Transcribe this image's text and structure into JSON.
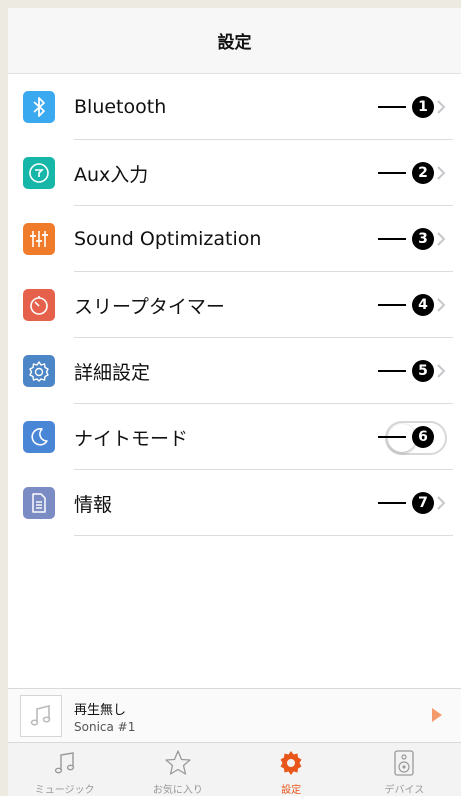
{
  "header": {
    "title": "設定"
  },
  "settings": {
    "items": [
      {
        "label": "Bluetooth",
        "icon": "bluetooth-icon",
        "color": "#3aa9f0",
        "marker": "1",
        "control": "chevron"
      },
      {
        "label": "Aux入力",
        "icon": "aux-input-icon",
        "color": "#16b6a8",
        "marker": "2",
        "control": "chevron"
      },
      {
        "label": "Sound Optimization",
        "icon": "equalizer-icon",
        "color": "#f07b2a",
        "marker": "3",
        "control": "chevron"
      },
      {
        "label": "スリープタイマー",
        "icon": "timer-icon",
        "color": "#e5614b",
        "marker": "4",
        "control": "chevron"
      },
      {
        "label": "詳細設定",
        "icon": "gear-icon",
        "color": "#4d86c6",
        "marker": "5",
        "control": "chevron"
      },
      {
        "label": "ナイトモード",
        "icon": "moon-icon",
        "color": "#4a86d6",
        "marker": "6",
        "control": "toggle",
        "toggle_on": false
      },
      {
        "label": "情報",
        "icon": "document-icon",
        "color": "#7b8cc4",
        "marker": "7",
        "control": "chevron"
      }
    ]
  },
  "player": {
    "title": "再生無し",
    "device": "Sonica #1",
    "icon": "music-note-icon"
  },
  "tabbar": {
    "active_color": "#e8561b",
    "tabs": [
      {
        "label": "ミュージック",
        "icon": "music-note-icon",
        "active": false
      },
      {
        "label": "お気に入り",
        "icon": "star-icon",
        "active": false
      },
      {
        "label": "設定",
        "icon": "gear-icon",
        "active": true
      },
      {
        "label": "デバイス",
        "icon": "speaker-icon",
        "active": false
      }
    ]
  }
}
